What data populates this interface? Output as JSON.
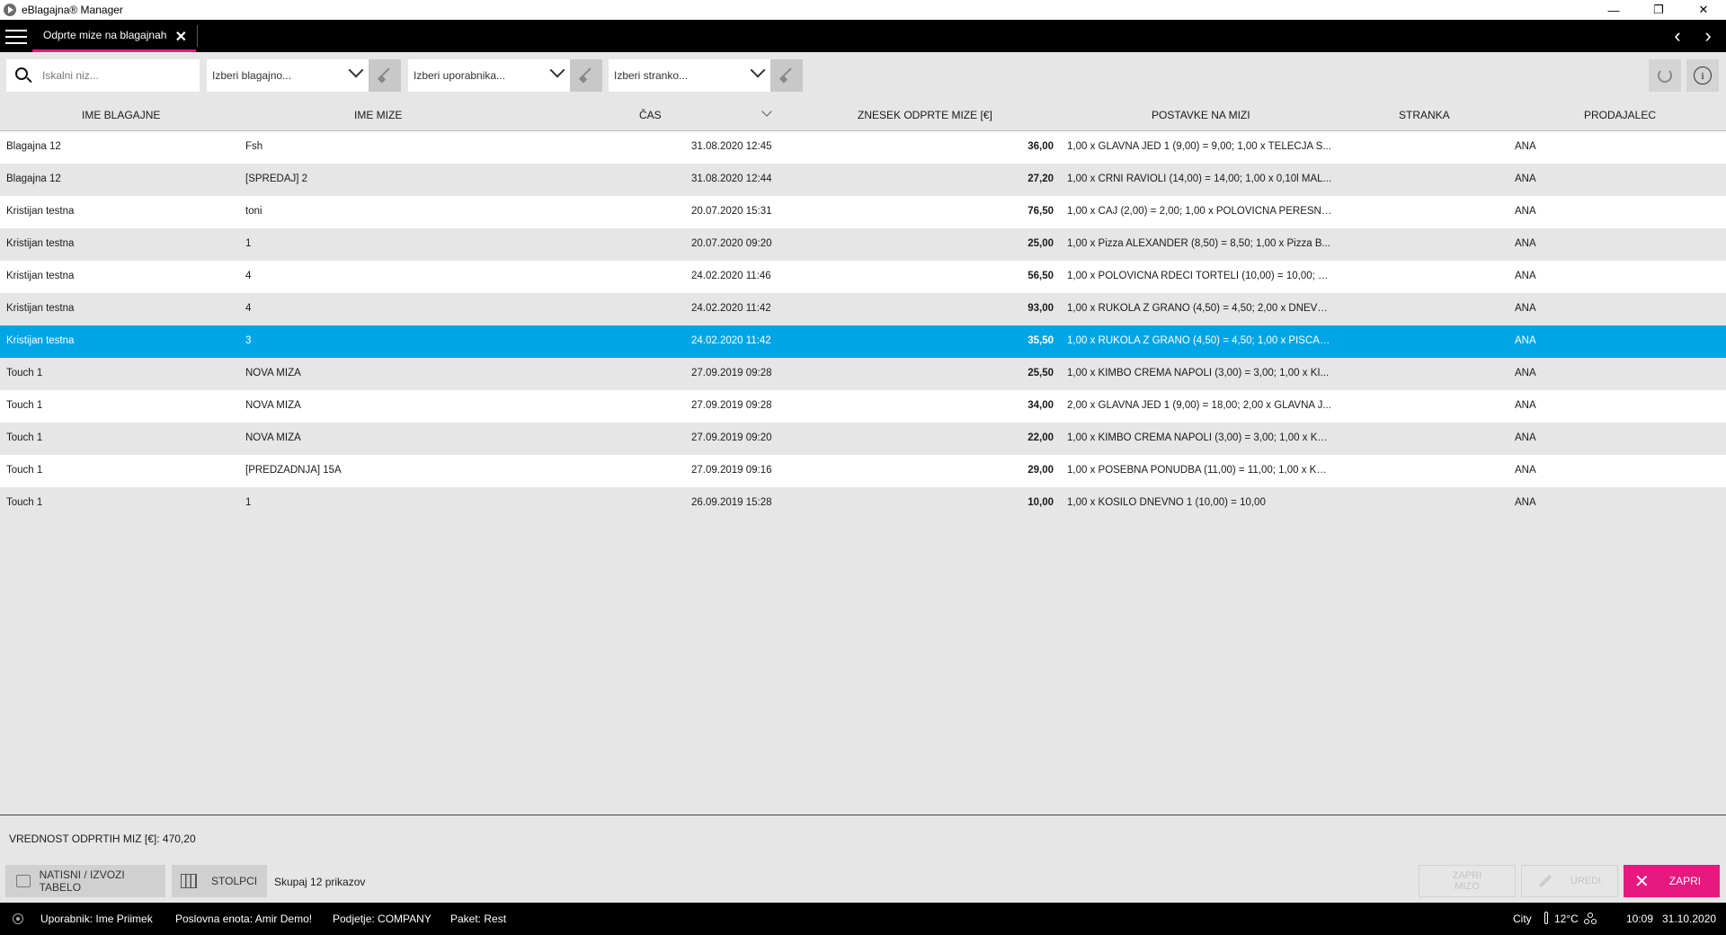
{
  "window": {
    "title": "eBlagajna® Manager",
    "minimize_glyph": "—",
    "restore_glyph": "❐",
    "close_glyph": "✕"
  },
  "tabs": [
    {
      "label": "Odprte mize na blagajnah",
      "active": true
    }
  ],
  "nav": {
    "prev_glyph": "‹",
    "next_glyph": "›"
  },
  "filters": {
    "search_placeholder": "Iskalni niz...",
    "register_placeholder": "Izberi blagajno...",
    "user_placeholder": "Izberi uporabnika...",
    "customer_placeholder": "Izberi stranko..."
  },
  "table": {
    "headers": {
      "ime_blagajne": "IME BLAGAJNE",
      "ime_mize": "IME MIZE",
      "cas": "ČAS",
      "znesek": "ZNESEK ODPRTE MIZE [€]",
      "postavke": "POSTAVKE NA MIZI",
      "stranka": "STRANKA",
      "prodajalec": "PRODAJALEC"
    },
    "sort_column": "ČAS",
    "sort_direction": "descending",
    "selected_row": 6,
    "rows": [
      {
        "blagajna": "Blagajna 12",
        "miza": "Fsh",
        "cas": "31.08.2020 12:45",
        "znesek": "36,00",
        "postavke": "1,00 x GLAVNA JED 1 (9,00) = 9,00; 1,00 x TELEČJA S...",
        "stranka": "",
        "prodajalec": "ANA"
      },
      {
        "blagajna": "Blagajna 12",
        "miza": "[SPREDAJ] 2",
        "cas": "31.08.2020 12:44",
        "znesek": "27,20",
        "postavke": "1,00 x ČRNI RAVIOLI (14,00) = 14,00; 1,00 x 0,10l MAL...",
        "stranka": "",
        "prodajalec": "ANA"
      },
      {
        "blagajna": "Kristijan testna",
        "miza": "toni",
        "cas": "20.07.2020 15:31",
        "znesek": "76,50",
        "postavke": "1,00 x ČAJ (2,00) = 2,00; 1,00 x POLOVIČNA PERESNI...",
        "stranka": "",
        "prodajalec": "ANA"
      },
      {
        "blagajna": "Kristijan testna",
        "miza": "1",
        "cas": "20.07.2020 09:20",
        "znesek": "25,00",
        "postavke": "1,00 x Pizza ALEXANDER (8,50) = 8,50; 1,00 x Pizza B...",
        "stranka": "",
        "prodajalec": "ANA"
      },
      {
        "blagajna": "Kristijan testna",
        "miza": "4",
        "cas": "24.02.2020 11:46",
        "znesek": "56,50",
        "postavke": "1,00 x POLOVIČNA RDEČI TORTELI (10,00) = 10,00; 1,...",
        "stranka": "",
        "prodajalec": "ANA"
      },
      {
        "blagajna": "Kristijan testna",
        "miza": "4",
        "cas": "24.02.2020 11:42",
        "znesek": "93,00",
        "postavke": "1,00 x RUKOLA Z GRANO (4,50) = 4,50; 2,00 x DNEVN...",
        "stranka": "",
        "prodajalec": "ANA"
      },
      {
        "blagajna": "Kristijan testna",
        "miza": "3",
        "cas": "24.02.2020 11:42",
        "znesek": "35,50",
        "postavke": "1,00 x RUKOLA Z GRANO (4,50) = 4,50; 1,00 x PIŠČAN...",
        "stranka": "",
        "prodajalec": "ANA"
      },
      {
        "blagajna": "Touch 1",
        "miza": "NOVA MIZA",
        "cas": "27.09.2019 09:28",
        "znesek": "25,50",
        "postavke": "1,00 x KIMBO CREMA NAPOLI (3,00) = 3,00; 1,00 x KI...",
        "stranka": "",
        "prodajalec": "ANA"
      },
      {
        "blagajna": "Touch 1",
        "miza": "NOVA MIZA",
        "cas": "27.09.2019 09:28",
        "znesek": "34,00",
        "postavke": "2,00 x GLAVNA JED 1 (9,00) = 18,00; 2,00 x GLAVNA J...",
        "stranka": "",
        "prodajalec": "ANA"
      },
      {
        "blagajna": "Touch 1",
        "miza": "NOVA MIZA",
        "cas": "27.09.2019 09:20",
        "znesek": "22,00",
        "postavke": "1,00 x KIMBO CREMA NAPOLI (3,00) = 3,00; 1,00 x KO...",
        "stranka": "",
        "prodajalec": "ANA"
      },
      {
        "blagajna": "Touch 1",
        "miza": "[PREDZADNJA] 15A",
        "cas": "27.09.2019 09:16",
        "znesek": "29,00",
        "postavke": "1,00 x POSEBNA PONUDBA (11,00) = 11,00; 1,00 x KO...",
        "stranka": "",
        "prodajalec": "ANA"
      },
      {
        "blagajna": "Touch 1",
        "miza": "1",
        "cas": "26.09.2019 15:28",
        "znesek": "10,00",
        "postavke": "1,00 x KOSILO DNEVNO 1 (10,00) = 10,00",
        "stranka": "",
        "prodajalec": "ANA"
      }
    ]
  },
  "summary": {
    "label": "VREDNOST ODPRTIH MIZ [€]: 470,20"
  },
  "actions": {
    "print_label": "NATISNI / IZVOZI TABELO",
    "columns_label": "STOLPCI",
    "count_label": "Skupaj 12 prikazov",
    "close_table_label": "ZAPRI MIZO",
    "edit_label": "UREDI",
    "close_label": "ZAPRI"
  },
  "status": {
    "user": "Uporabnik: Ime Priimek",
    "unit": "Poslovna enota: Amir Demo!",
    "company": "Podjetje: COMPANY",
    "package": "Paket: Rest",
    "city": "City",
    "temperature": "12°C",
    "time": "10:09",
    "date": "31.10.2020"
  },
  "colors": {
    "accent": "#e6197e",
    "selection": "#00a5e6",
    "bar": "#000000"
  }
}
